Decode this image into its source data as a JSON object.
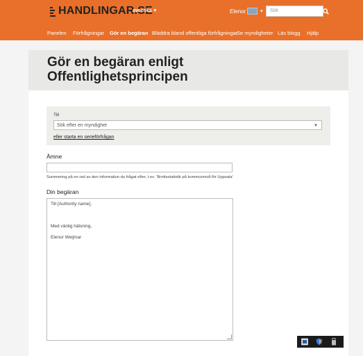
{
  "header": {
    "logo_text": "HANDLINGAR.SE",
    "language": "svenska",
    "user_name": "Elenor",
    "search_placeholder": "Sök"
  },
  "nav": {
    "items": [
      {
        "label": "Panelen",
        "active": false
      },
      {
        "label": "Förfrågningar",
        "active": false
      },
      {
        "label": "Gör en begäran",
        "active": true
      },
      {
        "label": "Bläddra bland offentliga förfrågningar",
        "active": false
      },
      {
        "label": "Se myndigheter",
        "active": false
      },
      {
        "label": "Läs blogg",
        "active": false
      },
      {
        "label": "Hjälp",
        "active": false
      }
    ]
  },
  "page": {
    "title_line1": "Gör en begäran enligt",
    "title_line2": "Offentlighetsprincipen"
  },
  "form": {
    "to_label": "Till",
    "authority_placeholder": "Sök efter en myndighet",
    "batch_link": "eller starta en serieförfrågan",
    "subject_label": "Ämne",
    "subject_value": "",
    "subject_help": "Summering på en rad av den information du frågat efter, t.ex. 'Brottsstatistik på kommunnivå för Uppsala'",
    "body_label": "Din begäran",
    "body_lines": [
      "Till [Authority name],",
      "",
      "",
      "",
      "Med vänlig hälsning,",
      "",
      "Elenor Weijmar"
    ]
  },
  "colors": {
    "brand_orange": "#e8702a",
    "title_band": "#e8e8e6",
    "panel_bg": "#eeeeeb"
  }
}
